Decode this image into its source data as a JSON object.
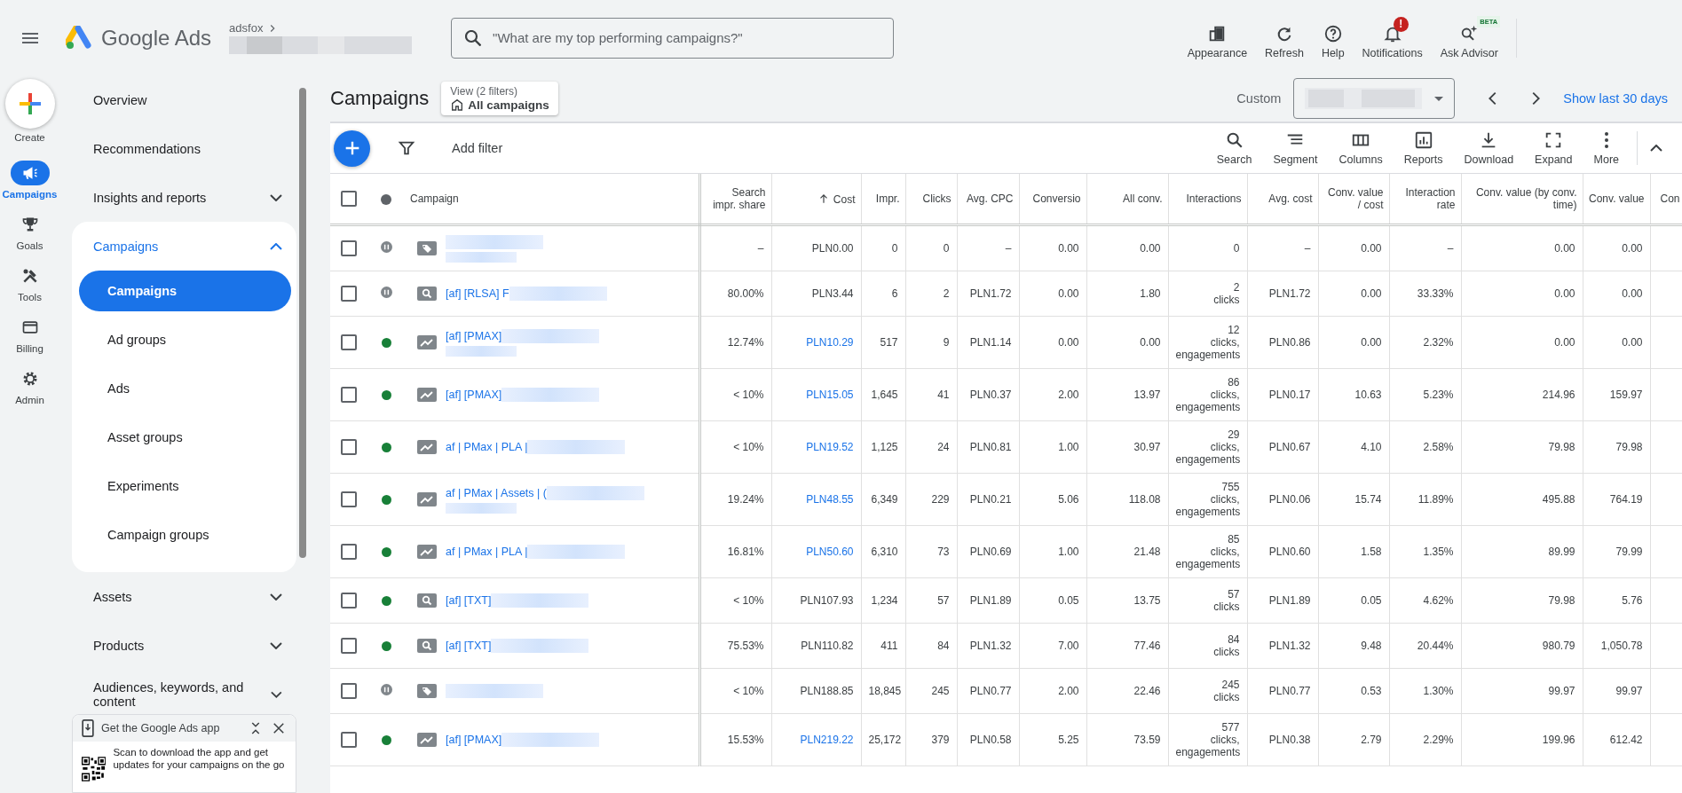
{
  "topbar": {
    "product": "Google Ads",
    "account": "adsfox",
    "search": {
      "placeholder": "\"What are my top performing campaigns?\""
    },
    "actions": [
      {
        "kind": "appearance",
        "label": "Appearance"
      },
      {
        "kind": "refresh",
        "label": "Refresh"
      },
      {
        "kind": "help",
        "label": "Help"
      },
      {
        "kind": "notifications",
        "label": "Notifications",
        "badge": "!"
      },
      {
        "kind": "advisor",
        "label": "Ask Advisor",
        "badge": "BETA"
      }
    ]
  },
  "create": {
    "label": "Create"
  },
  "rail": [
    {
      "kind": "campaigns",
      "label": "Campaigns",
      "selected": true
    },
    {
      "kind": "goals",
      "label": "Goals",
      "selected": false
    },
    {
      "kind": "tools",
      "label": "Tools",
      "selected": false
    },
    {
      "kind": "billing",
      "label": "Billing",
      "selected": false
    },
    {
      "kind": "admin",
      "label": "Admin",
      "selected": false
    }
  ],
  "sidebar": {
    "items": [
      {
        "kind": "link",
        "label": "Overview"
      },
      {
        "kind": "link",
        "label": "Recommendations"
      },
      {
        "kind": "group",
        "label": "Insights and reports",
        "expanded": false
      },
      {
        "kind": "group",
        "label": "Campaigns",
        "expanded": true,
        "children": [
          {
            "label": "Campaigns",
            "selected": true
          },
          {
            "label": "Ad groups",
            "selected": false
          },
          {
            "label": "Ads",
            "selected": false
          },
          {
            "label": "Asset groups",
            "selected": false
          },
          {
            "label": "Experiments",
            "selected": false
          },
          {
            "label": "Campaign groups",
            "selected": false
          }
        ]
      },
      {
        "kind": "group",
        "label": "Assets",
        "expanded": false
      },
      {
        "kind": "group",
        "label": "Products",
        "expanded": false
      },
      {
        "kind": "group",
        "label": "Audiences, keywords, and content",
        "expanded": false
      }
    ],
    "app_promo": {
      "title": "Get the Google Ads app",
      "text": "Scan to download the app and get updates for your campaigns on the go"
    }
  },
  "page": {
    "title": "Campaigns",
    "view": {
      "label": "View (2 filters)",
      "value": "All campaigns"
    },
    "date": {
      "label": "Custom"
    },
    "range_link": "Show last 30 days"
  },
  "toolbar": {
    "filter_label": "Add filter",
    "tools": [
      {
        "kind": "search",
        "label": "Search"
      },
      {
        "kind": "segment",
        "label": "Segment"
      },
      {
        "kind": "columns",
        "label": "Columns"
      },
      {
        "kind": "reports",
        "label": "Reports"
      },
      {
        "kind": "download",
        "label": "Download"
      },
      {
        "kind": "expand",
        "label": "Expand"
      },
      {
        "kind": "more",
        "label": "More"
      }
    ]
  },
  "table": {
    "all_selected": false,
    "columns": [
      {
        "label": "Campaign",
        "sorted": false
      },
      {
        "label": "Search\nimpr. share",
        "sorted": false
      },
      {
        "label": "Cost",
        "sorted": true
      },
      {
        "label": "Impr.",
        "sorted": false
      },
      {
        "label": "Clicks",
        "sorted": false
      },
      {
        "label": "Avg. CPC",
        "sorted": false
      },
      {
        "label": "Conversio",
        "sorted": false
      },
      {
        "label": "All conv.",
        "sorted": false
      },
      {
        "label": "Interactions",
        "sorted": false
      },
      {
        "label": "Avg. cost",
        "sorted": false
      },
      {
        "label": "Conv. value\n/ cost",
        "sorted": false
      },
      {
        "label": "Interaction\nrate",
        "sorted": false
      },
      {
        "label": "Conv. value (by conv.\ntime)",
        "sorted": false
      },
      {
        "label": "Conv. value",
        "sorted": false
      },
      {
        "label": "Con",
        "sorted": false
      }
    ],
    "rows": [
      {
        "selected": false,
        "enabled": false,
        "kind": "display",
        "two_line": true,
        "cost_link": false,
        "cells": [
          "",
          "–",
          "PLN0.00",
          "0",
          "0",
          "–",
          "0.00",
          "0.00",
          "0",
          "–",
          "0.00",
          "–",
          "0.00",
          "0.00"
        ]
      },
      {
        "selected": false,
        "enabled": false,
        "kind": "search",
        "two_line": false,
        "cost_link": false,
        "cells": [
          "[af] [RLSA] F",
          "80.00%",
          "PLN3.44",
          "6",
          "2",
          "PLN1.72",
          "0.00",
          "1.80",
          "2\nclicks",
          "PLN1.72",
          "0.00",
          "33.33%",
          "0.00",
          "0.00"
        ]
      },
      {
        "selected": false,
        "enabled": true,
        "kind": "pmax",
        "two_line": true,
        "cost_link": true,
        "cells": [
          "[af] [PMAX]",
          "12.74%",
          "PLN10.29",
          "517",
          "9",
          "PLN1.14",
          "0.00",
          "0.00",
          "12\nclicks, engagements",
          "PLN0.86",
          "0.00",
          "2.32%",
          "0.00",
          "0.00"
        ]
      },
      {
        "selected": false,
        "enabled": true,
        "kind": "pmax",
        "two_line": false,
        "cost_link": true,
        "cells": [
          "[af] [PMAX]",
          "< 10%",
          "PLN15.05",
          "1,645",
          "41",
          "PLN0.37",
          "2.00",
          "13.97",
          "86\nclicks, engagements",
          "PLN0.17",
          "10.63",
          "5.23%",
          "214.96",
          "159.97"
        ]
      },
      {
        "selected": false,
        "enabled": true,
        "kind": "pmax",
        "two_line": false,
        "cost_link": true,
        "cells": [
          "af | PMax | PLA |",
          "< 10%",
          "PLN19.52",
          "1,125",
          "24",
          "PLN0.81",
          "1.00",
          "30.97",
          "29\nclicks, engagements",
          "PLN0.67",
          "4.10",
          "2.58%",
          "79.98",
          "79.98"
        ]
      },
      {
        "selected": false,
        "enabled": true,
        "kind": "pmax",
        "two_line": true,
        "cost_link": true,
        "cells": [
          "af | PMax | Assets | (",
          "19.24%",
          "PLN48.55",
          "6,349",
          "229",
          "PLN0.21",
          "5.06",
          "118.08",
          "755\nclicks, engagements",
          "PLN0.06",
          "15.74",
          "11.89%",
          "495.88",
          "764.19"
        ]
      },
      {
        "selected": false,
        "enabled": true,
        "kind": "pmax",
        "two_line": false,
        "cost_link": true,
        "cells": [
          "af | PMax | PLA |",
          "16.81%",
          "PLN50.60",
          "6,310",
          "73",
          "PLN0.69",
          "1.00",
          "21.48",
          "85\nclicks, engagements",
          "PLN0.60",
          "1.58",
          "1.35%",
          "89.99",
          "79.99"
        ]
      },
      {
        "selected": false,
        "enabled": true,
        "kind": "search",
        "two_line": false,
        "cost_link": false,
        "cells": [
          "[af] [TXT]",
          "< 10%",
          "PLN107.93",
          "1,234",
          "57",
          "PLN1.89",
          "0.05",
          "13.75",
          "57\nclicks",
          "PLN1.89",
          "0.05",
          "4.62%",
          "79.98",
          "5.76"
        ]
      },
      {
        "selected": false,
        "enabled": true,
        "kind": "search",
        "two_line": false,
        "cost_link": false,
        "cells": [
          "[af] [TXT]",
          "75.53%",
          "PLN110.82",
          "411",
          "84",
          "PLN1.32",
          "7.00",
          "77.46",
          "84\nclicks",
          "PLN1.32",
          "9.48",
          "20.44%",
          "980.79",
          "1,050.78"
        ]
      },
      {
        "selected": false,
        "enabled": false,
        "kind": "display",
        "two_line": false,
        "cost_link": false,
        "cells": [
          "",
          "< 10%",
          "PLN188.85",
          "18,845",
          "245",
          "PLN0.77",
          "2.00",
          "22.46",
          "245\nclicks",
          "PLN0.77",
          "0.53",
          "1.30%",
          "99.97",
          "99.97"
        ]
      },
      {
        "selected": false,
        "enabled": true,
        "kind": "pmax",
        "two_line": false,
        "cost_link": true,
        "cells": [
          "[af] [PMAX]",
          "15.53%",
          "PLN219.22",
          "25,172",
          "379",
          "PLN0.58",
          "5.25",
          "73.59",
          "577\nclicks, engagements",
          "PLN0.38",
          "2.79",
          "2.29%",
          "199.96",
          "612.42"
        ]
      }
    ]
  }
}
